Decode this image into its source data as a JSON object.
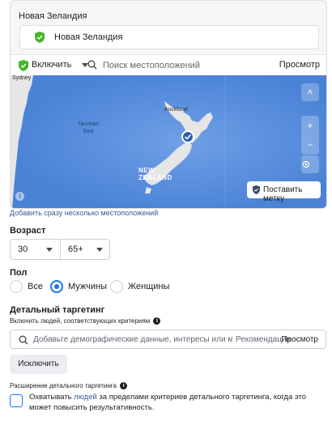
{
  "location": {
    "header_title": "Новая Зеландия",
    "selected_location": "Новая Зеландия",
    "include_label": "Включить",
    "search_placeholder": "Поиск местоположений",
    "browse_label": "Просмотр",
    "map": {
      "label_sydney": "Sydney",
      "label_sea": "Tasman Sea",
      "label_country": "NEW ZEALAND",
      "label_auckland": "Auckland",
      "drop_pin_label": "Поставить метку",
      "zoom_in": "+",
      "zoom_out": "−",
      "collapse": "˄",
      "info": "i"
    },
    "bulk_add_link": "Добавить сразу несколько местоположений"
  },
  "age": {
    "title": "Возраст",
    "min": "30",
    "max": "65+"
  },
  "gender": {
    "title": "Пол",
    "options": [
      {
        "label": "Все",
        "checked": false
      },
      {
        "label": "Мужчины",
        "checked": true
      },
      {
        "label": "Женщины",
        "checked": false
      }
    ]
  },
  "detailed": {
    "title": "Детальный таргетинг",
    "include_text": "Включить людей, соответствующих критериям",
    "input_placeholder": "Добавьте демографические данные, интересы или м",
    "recommendations": "Рекомендации",
    "browse_label": "Просмотр",
    "exclude_label": "Исключить",
    "expansion_title": "Расширение детального таргетинга",
    "expansion_text_pre": "Охватывать ",
    "expansion_link": "людей",
    "expansion_text_post": " за пределами критериев детального таргетинга, когда это может повысить результативность.",
    "expansion_checked": false
  },
  "colors": {
    "accent": "#1877f2",
    "shield_green": "#42b72a",
    "map_water": "#4a82d6",
    "map_land": "#e6e6e6",
    "link": "#385898"
  }
}
